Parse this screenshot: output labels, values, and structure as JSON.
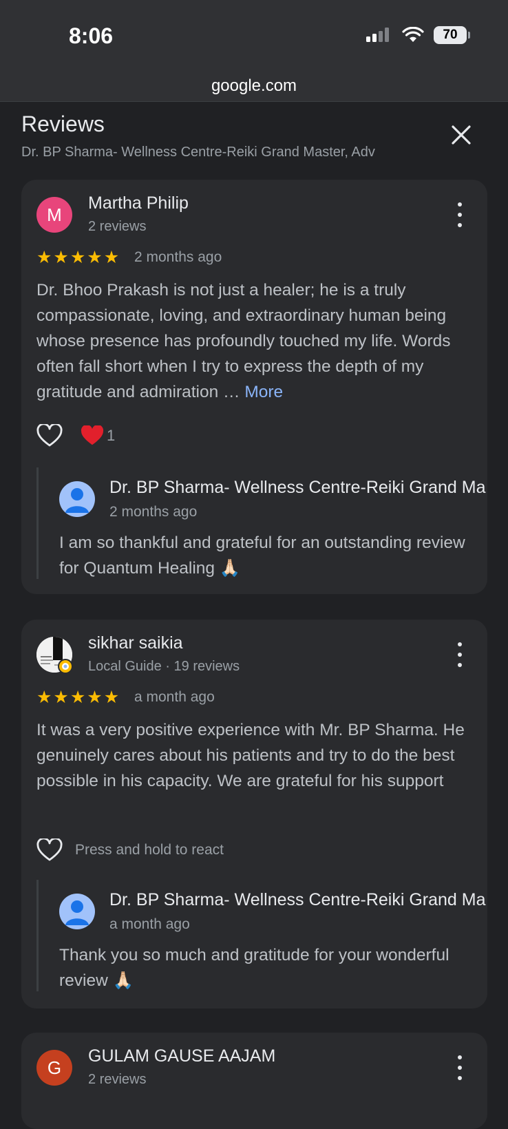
{
  "status": {
    "time": "8:06",
    "battery": "70"
  },
  "browser": {
    "url": "google.com"
  },
  "sheet": {
    "title": "Reviews",
    "subtitle": "Dr. BP Sharma- Wellness Centre-Reiki Grand Master, Adv"
  },
  "reviews": [
    {
      "avatar_letter": "M",
      "avatar_color": "#e8457b",
      "name": "Martha Philip",
      "meta": "2 reviews",
      "rating": 5,
      "time": "2 months ago",
      "text": "Dr. Bhoo Prakash is not just a healer; he is a truly compassionate, loving, and extraordinary human being whose presence has profoundly touched my life. Words often fall short when I try to express the depth of my gratitude and admiration …",
      "more": "More",
      "reaction_count": "1",
      "owner_reply": {
        "name": "Dr. BP Sharma- Wellness Centre-Reiki Grand Ma",
        "time": "2 months ago",
        "text": "I am so thankful and grateful for an outstanding review for Quantum Healing 🙏🏻"
      }
    },
    {
      "name": "sikhar saikia",
      "meta": "Local Guide · 19 reviews",
      "rating": 5,
      "time": "a month ago",
      "text": "It was a very positive experience with Mr. BP Sharma. He genuinely cares about his patients and try to do the best possible in his capacity. We are grateful for his support",
      "react_hint": "Press and hold to react",
      "owner_reply": {
        "name": "Dr. BP Sharma- Wellness Centre-Reiki Grand Ma",
        "time": "a month ago",
        "text": "Thank you so much and gratitude for your wonderful review 🙏🏻"
      }
    },
    {
      "avatar_letter": "G",
      "avatar_color": "#c5401f",
      "name": "GULAM GAUSE AAJAM",
      "meta": "2 reviews"
    }
  ]
}
